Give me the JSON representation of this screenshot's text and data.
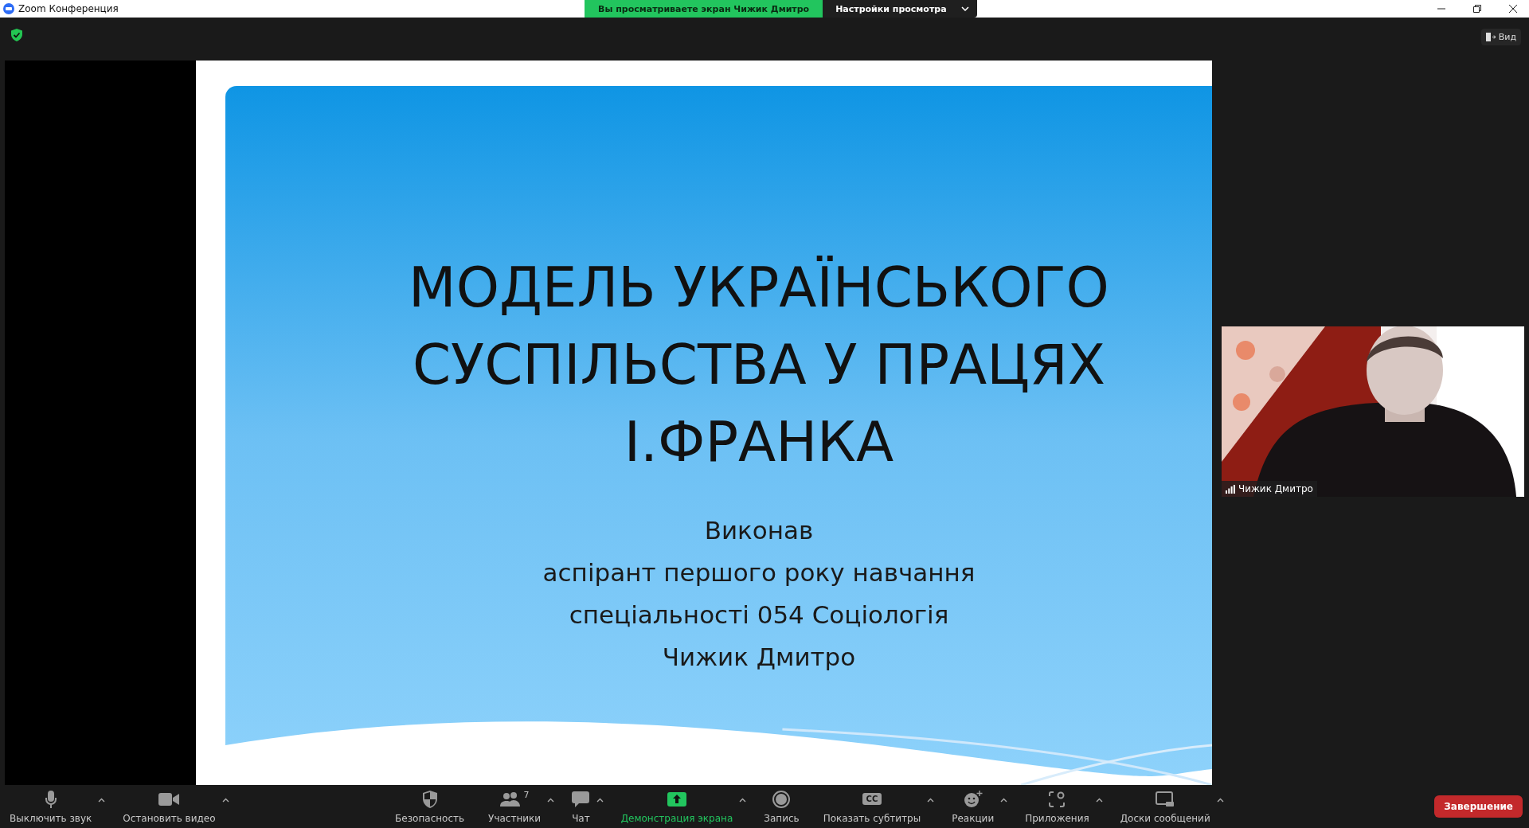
{
  "window": {
    "title": "Zoom Конференция"
  },
  "banner": {
    "viewing": "Вы просматриваете экран Чижик Дмитро",
    "options": "Настройки просмотра"
  },
  "view_button": "Вид",
  "slide": {
    "title_lines": [
      "МОДЕЛЬ УКРАЇНСЬКОГО",
      "СУСПІЛЬСТВА У ПРАЦЯХ",
      "І.ФРАНКА"
    ],
    "body_lines": [
      "Виконав",
      "аспірант першого року навчання",
      "спеціальності 054 Соціологія",
      "Чижик Дмитро"
    ]
  },
  "participant": {
    "name": "Чижик Дмитро"
  },
  "toolbar": [
    {
      "kind": "mic",
      "label": "Выключить звук",
      "caret": true,
      "highlighted": false
    },
    {
      "kind": "video",
      "label": "Остановить видео",
      "caret": true,
      "highlighted": false
    },
    {
      "kind": "security",
      "label": "Безопасность",
      "caret": false,
      "highlighted": false
    },
    {
      "kind": "participants",
      "label": "Участники",
      "count": "7",
      "caret": true,
      "highlighted": false
    },
    {
      "kind": "chat",
      "label": "Чат",
      "caret": true,
      "highlighted": false
    },
    {
      "kind": "share",
      "label": "Демонстрация экрана",
      "caret": true,
      "highlighted": true
    },
    {
      "kind": "record",
      "label": "Запись",
      "caret": false,
      "highlighted": false
    },
    {
      "kind": "cc",
      "label": "Показать субтитры",
      "icon_text": "CC",
      "caret": true,
      "highlighted": false
    },
    {
      "kind": "reactions",
      "label": "Реакции",
      "caret": true,
      "highlighted": false
    },
    {
      "kind": "apps",
      "label": "Приложения",
      "caret": true,
      "highlighted": false
    },
    {
      "kind": "whiteboard",
      "label": "Доски сообщений",
      "caret": true,
      "highlighted": false
    }
  ],
  "end_button": "Завершение"
}
